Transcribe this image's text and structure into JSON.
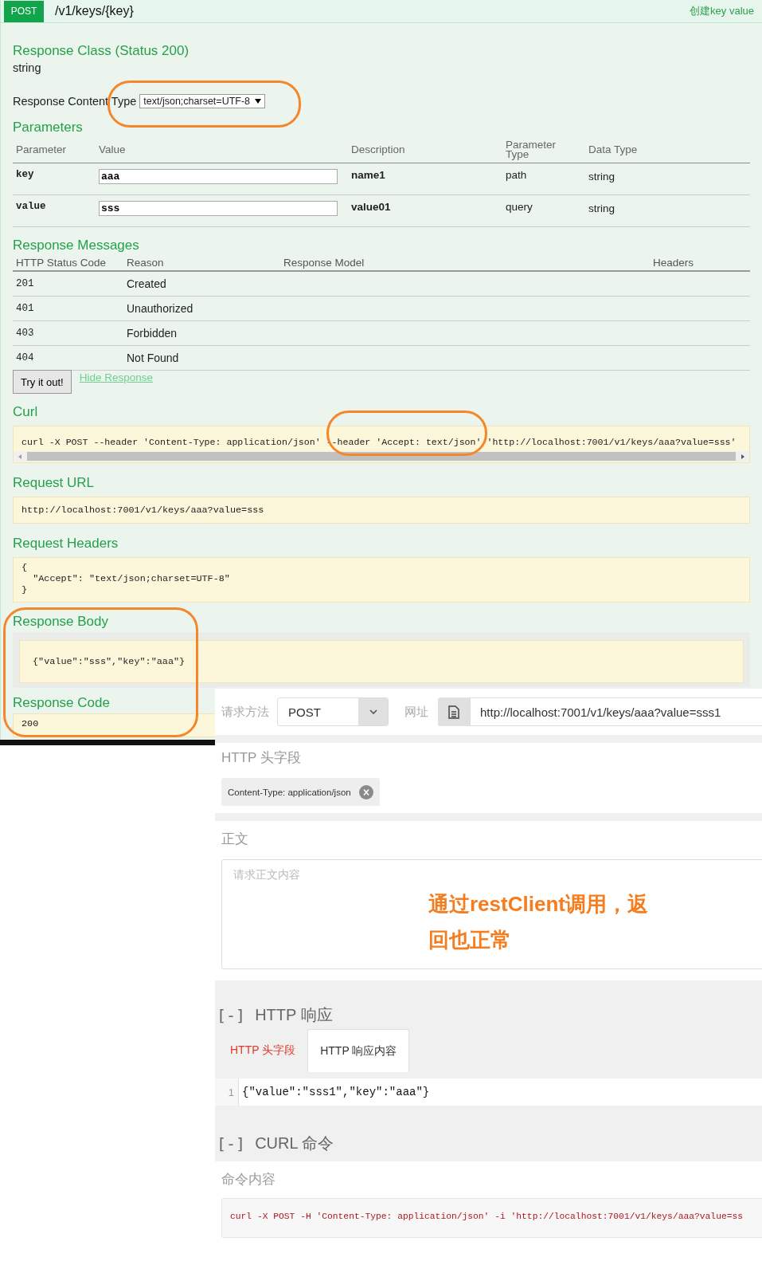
{
  "swagger": {
    "operation": {
      "method": "POST",
      "path": "/v1/keys/{key}",
      "summary": "创建key value"
    },
    "response_class": {
      "heading": "Response Class (Status 200)",
      "type": "string"
    },
    "response_content_type": {
      "label": "Response Content Type",
      "value": "text/json;charset=UTF-8"
    },
    "parameters": {
      "heading": "Parameters",
      "columns": [
        "Parameter",
        "Value",
        "Description",
        "Parameter Type",
        "Data Type"
      ],
      "rows": [
        {
          "name": "key",
          "value": "aaa",
          "description": "name1",
          "parameter_type": "path",
          "data_type": "string"
        },
        {
          "name": "value",
          "value": "sss",
          "description": "value01",
          "parameter_type": "query",
          "data_type": "string"
        }
      ]
    },
    "response_messages": {
      "heading": "Response Messages",
      "columns": [
        "HTTP Status Code",
        "Reason",
        "Response Model",
        "Headers"
      ],
      "rows": [
        {
          "code": "201",
          "reason": "Created"
        },
        {
          "code": "401",
          "reason": "Unauthorized"
        },
        {
          "code": "403",
          "reason": "Forbidden"
        },
        {
          "code": "404",
          "reason": "Not Found"
        }
      ]
    },
    "try_button": "Try it out!",
    "hide_response_link": "Hide Response",
    "curl": {
      "heading": "Curl",
      "command": "curl -X POST --header 'Content-Type: application/json' --header 'Accept: text/json' 'http://localhost:7001/v1/keys/aaa?value=sss'"
    },
    "request_url": {
      "heading": "Request URL",
      "value": "http://localhost:7001/v1/keys/aaa?value=sss"
    },
    "request_headers": {
      "heading": "Request Headers",
      "value": "{\n  \"Accept\": \"text/json;charset=UTF-8\"\n}"
    },
    "response_body": {
      "heading": "Response Body",
      "value": "{\"value\":\"sss\",\"key\":\"aaa\"}"
    },
    "response_code": {
      "heading": "Response Code",
      "value": "200"
    }
  },
  "rest_client": {
    "method_label": "请求方法",
    "method": "POST",
    "url_label": "网址",
    "url": "http://localhost:7001/v1/keys/aaa?value=sss1",
    "headers": {
      "heading": "HTTP 头字段",
      "chips": [
        "Content-Type: application/json"
      ]
    },
    "body": {
      "heading": "正文",
      "placeholder": "请求正文内容"
    },
    "response": {
      "toggle": "[-]",
      "heading": "HTTP 响应",
      "tabs": [
        {
          "label": "HTTP 头字段",
          "selected": false
        },
        {
          "label": "HTTP 响应内容",
          "selected": true
        }
      ],
      "lines": [
        {
          "number": "1",
          "text": "{\"value\":\"sss1\",\"key\":\"aaa\"}"
        }
      ]
    },
    "curl": {
      "toggle": "[-]",
      "heading": "CURL 命令",
      "label": "命令内容",
      "command": "curl -X POST -H 'Content-Type: application/json' -i 'http://localhost:7001/v1/keys/aaa?value=ss"
    }
  },
  "annotation": "通过restClient调用，返回也正常"
}
